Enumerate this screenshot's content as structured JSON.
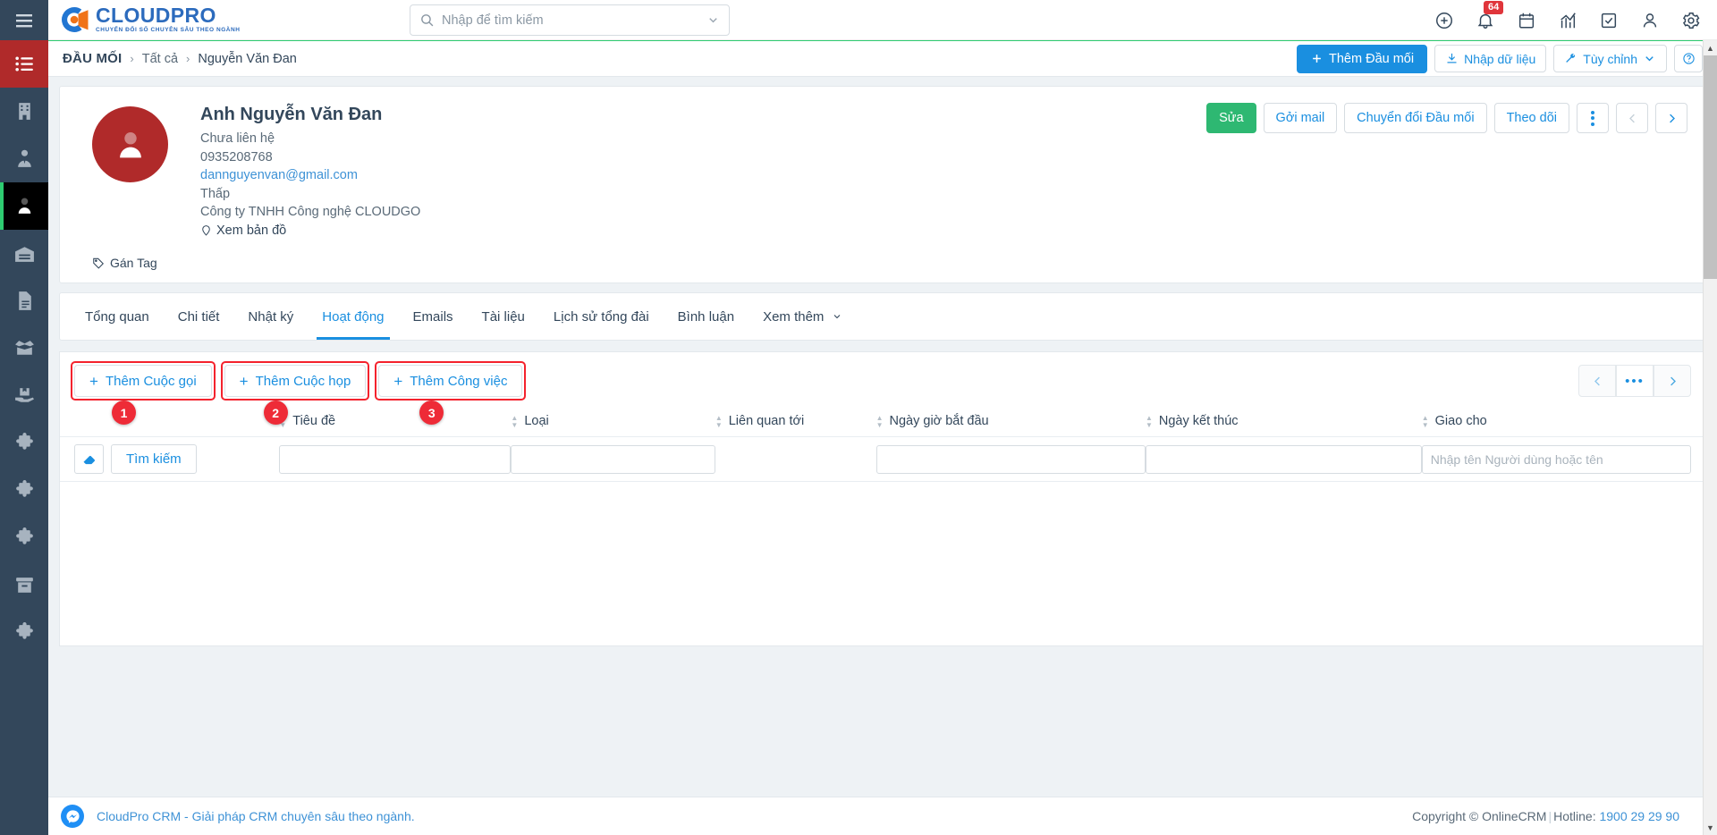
{
  "brand": {
    "name": "CLOUDPRO",
    "tagline": "CHUYỂN ĐỔI SỐ CHUYÊN SÂU THEO NGÀNH"
  },
  "search": {
    "placeholder": "Nhập để tìm kiếm",
    "value": ""
  },
  "topbar": {
    "icons": [
      {
        "name": "add-circle-icon",
        "label": "Thêm"
      },
      {
        "name": "bell-icon",
        "label": "Thông báo",
        "badge": "64"
      },
      {
        "name": "calendar-icon",
        "label": "Lịch"
      },
      {
        "name": "chart-icon",
        "label": "Báo cáo"
      },
      {
        "name": "task-check-icon",
        "label": "Công việc"
      },
      {
        "name": "user-icon",
        "label": "Tài khoản"
      },
      {
        "name": "gear-icon",
        "label": "Cài đặt"
      }
    ],
    "notification_count": "64"
  },
  "sidebar": {
    "items": [
      {
        "name": "sidebar-item-menu",
        "icon": "list-icon",
        "state": "active-red"
      },
      {
        "name": "sidebar-item-company",
        "icon": "building-icon",
        "state": "normal"
      },
      {
        "name": "sidebar-item-contacts",
        "icon": "user-tie-icon",
        "state": "normal"
      },
      {
        "name": "sidebar-item-leads",
        "icon": "person-icon",
        "state": "active-dark"
      },
      {
        "name": "sidebar-item-warehouse",
        "icon": "warehouse-icon",
        "state": "normal"
      },
      {
        "name": "sidebar-item-documents",
        "icon": "document-icon",
        "state": "normal"
      },
      {
        "name": "sidebar-item-products",
        "icon": "open-box-icon",
        "state": "normal"
      },
      {
        "name": "sidebar-item-delivery",
        "icon": "package-hand-icon",
        "state": "normal"
      },
      {
        "name": "sidebar-item-extensions",
        "icon": "puzzle-icon",
        "state": "normal"
      },
      {
        "name": "sidebar-item-addons",
        "icon": "puzzle-icon",
        "state": "normal"
      },
      {
        "name": "sidebar-item-integrations",
        "icon": "puzzle-icon",
        "state": "normal"
      },
      {
        "name": "sidebar-item-modules",
        "icon": "archive-icon",
        "state": "normal"
      },
      {
        "name": "sidebar-item-plugins",
        "icon": "puzzle-icon",
        "state": "normal"
      },
      {
        "name": "sidebar-item-more",
        "icon": "puzzle-icon",
        "state": "normal"
      }
    ]
  },
  "breadcrumb": {
    "root": "ĐẦU MỐI",
    "middle": "Tất cả",
    "current": "Nguyễn Văn Đan",
    "separator": "›"
  },
  "page_actions": {
    "add_lead": "Thêm Đầu mối",
    "import": "Nhập dữ liệu",
    "customize": "Tùy chỉnh",
    "help": "?"
  },
  "profile": {
    "name": "Anh Nguyễn Văn Đan",
    "status": "Chưa liên hệ",
    "phone": "0935208768",
    "email": "dannguyenvan@gmail.com",
    "rating": "Thấp",
    "company": "Công ty TNHH Công nghệ CLOUDGO",
    "map_link": "Xem bản đồ",
    "tag_label": "Gán Tag",
    "actions": {
      "edit": "Sửa",
      "send_mail": "Gởi mail",
      "convert": "Chuyển đổi Đầu mối",
      "follow": "Theo dõi",
      "more": "⋮",
      "prev": "‹",
      "next": "›"
    }
  },
  "tabs": [
    {
      "label": "Tổng quan",
      "active": false
    },
    {
      "label": "Chi tiết",
      "active": false
    },
    {
      "label": "Nhật ký",
      "active": false
    },
    {
      "label": "Hoạt động",
      "active": true
    },
    {
      "label": "Emails",
      "active": false
    },
    {
      "label": "Tài liệu",
      "active": false
    },
    {
      "label": "Lịch sử tổng đài",
      "active": false
    },
    {
      "label": "Bình luận",
      "active": false
    },
    {
      "label": "Xem thêm",
      "active": false,
      "has_chevron": true
    }
  ],
  "activity": {
    "add_buttons": [
      {
        "label": "Thêm Cuộc gọi",
        "marker": "1",
        "highlighted": true
      },
      {
        "label": "Thêm Cuộc họp",
        "marker": "2",
        "highlighted": true
      },
      {
        "label": "Thêm Công việc",
        "marker": "3",
        "highlighted": true
      }
    ],
    "pager": {
      "prev": "‹",
      "mid": "•••",
      "next": "›"
    },
    "columns": [
      {
        "label": "Tiêu đề",
        "sortable": true
      },
      {
        "label": "Loại",
        "sortable": true
      },
      {
        "label": "Liên quan tới",
        "sortable": true
      },
      {
        "label": "Ngày giờ bắt đầu",
        "sortable": true
      },
      {
        "label": "Ngày kết thúc",
        "sortable": true
      },
      {
        "label": "Giao cho",
        "sortable": true
      }
    ],
    "filter_row": {
      "eraser": "eraser-icon",
      "search_button": "Tìm kiếm",
      "title_value": "",
      "type_value": "",
      "start_value": "",
      "end_value": "",
      "assignee_placeholder": "Nhập tên Người dùng hoặc tên",
      "assignee_value": ""
    },
    "rows": []
  },
  "footer": {
    "left_text": "CloudPro CRM - Giải pháp CRM chuyên sâu theo ngành.",
    "copyright": "Copyright © OnlineCRM",
    "separator": "|",
    "hotline_label": "Hotline:",
    "hotline": "1900 29 29 90"
  },
  "colors": {
    "accent_blue": "#1a8fe0",
    "green": "#2eb872",
    "sidebar": "#33475b",
    "red_badge": "#e0353b",
    "annotation_red": "#f4222d",
    "avatar_red": "#b02a2a"
  }
}
